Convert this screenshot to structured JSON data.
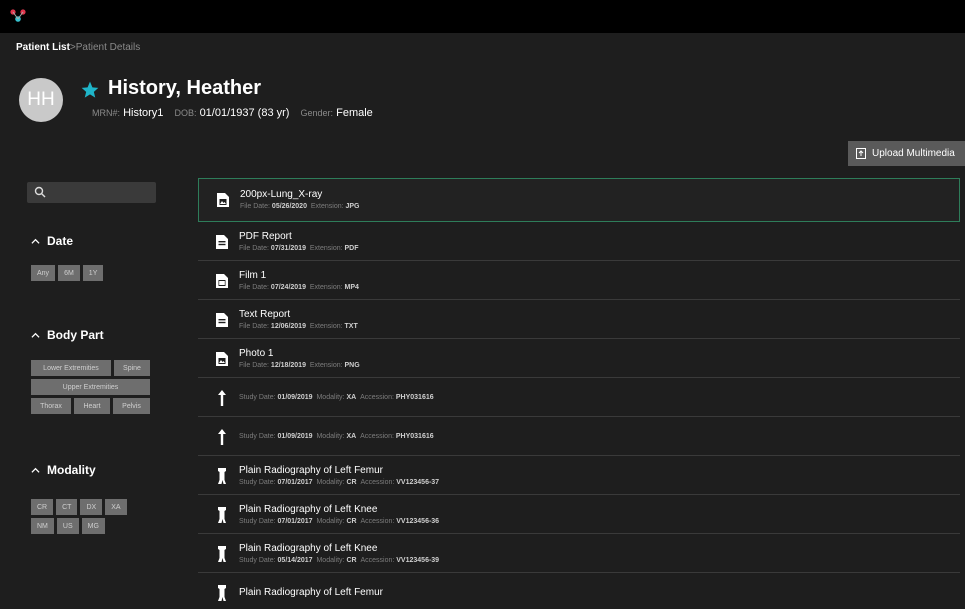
{
  "breadcrumb": {
    "root": "Patient List",
    "separator": ">",
    "current": "Patient Details"
  },
  "patient": {
    "initials": "HH",
    "name": "History, Heather",
    "mrn_label": "MRN#:",
    "mrn": "History1",
    "dob_label": "DOB:",
    "dob": "01/01/1937 (83 yr)",
    "gender_label": "Gender:",
    "gender": "Female",
    "favorite_color": "#1fb5c9"
  },
  "upload_button": {
    "label": "Upload Multimedia"
  },
  "filters": {
    "date": {
      "title": "Date",
      "options": [
        "Any",
        "6M",
        "1Y"
      ]
    },
    "body_part": {
      "title": "Body Part",
      "rows": [
        [
          "Lower Extremities",
          "Spine"
        ],
        [
          "Upper Extremities"
        ],
        [
          "Thorax",
          "Heart",
          "Pelvis"
        ]
      ]
    },
    "modality": {
      "title": "Modality",
      "rows": [
        [
          "CR",
          "CT",
          "DX",
          "XA"
        ],
        [
          "NM",
          "US",
          "MG"
        ]
      ]
    }
  },
  "items": [
    {
      "kind": "image-file",
      "title": "200px-Lung_X-ray",
      "l1": "File Date:",
      "v1": "05/26/2020",
      "l2": "Extension:",
      "v2": "JPG",
      "selected": true
    },
    {
      "kind": "doc-file",
      "title": "PDF Report",
      "l1": "File Date:",
      "v1": "07/31/2019",
      "l2": "Extension:",
      "v2": "PDF"
    },
    {
      "kind": "video-file",
      "title": "Film 1",
      "l1": "File Date:",
      "v1": "07/24/2019",
      "l2": "Extension:",
      "v2": "MP4"
    },
    {
      "kind": "doc-file",
      "title": "Text Report",
      "l1": "File Date:",
      "v1": "12/06/2019",
      "l2": "Extension:",
      "v2": "TXT"
    },
    {
      "kind": "image-file",
      "title": "Photo 1",
      "l1": "File Date:",
      "v1": "12/18/2019",
      "l2": "Extension:",
      "v2": "PNG"
    },
    {
      "kind": "arm-study",
      "title": "",
      "l1": "Study Date:",
      "v1": "01/09/2019",
      "l2": "Modality:",
      "v2": "XA",
      "l3": "Accession:",
      "v3": "PHY031616"
    },
    {
      "kind": "arm-study",
      "title": "",
      "l1": "Study Date:",
      "v1": "01/09/2019",
      "l2": "Modality:",
      "v2": "XA",
      "l3": "Accession:",
      "v3": "PHY031616"
    },
    {
      "kind": "leg-study",
      "title": "Plain Radiography of Left Femur",
      "l1": "Study Date:",
      "v1": "07/01/2017",
      "l2": "Modality:",
      "v2": "CR",
      "l3": "Accession:",
      "v3": "VV123456-37"
    },
    {
      "kind": "leg-study",
      "title": "Plain Radiography of Left Knee",
      "l1": "Study Date:",
      "v1": "07/01/2017",
      "l2": "Modality:",
      "v2": "CR",
      "l3": "Accession:",
      "v3": "VV123456-36"
    },
    {
      "kind": "leg-study",
      "title": "Plain Radiography of Left Knee",
      "l1": "Study Date:",
      "v1": "05/14/2017",
      "l2": "Modality:",
      "v2": "CR",
      "l3": "Accession:",
      "v3": "VV123456-39"
    },
    {
      "kind": "leg-study",
      "title": "Plain Radiography of Left Femur",
      "l1": "",
      "v1": "",
      "l2": "",
      "v2": "",
      "l3": "",
      "v3": ""
    }
  ],
  "colors": {
    "selection_border": "#2e7d5a",
    "logo_red": "#e2364e",
    "logo_teal": "#36c2cf"
  }
}
